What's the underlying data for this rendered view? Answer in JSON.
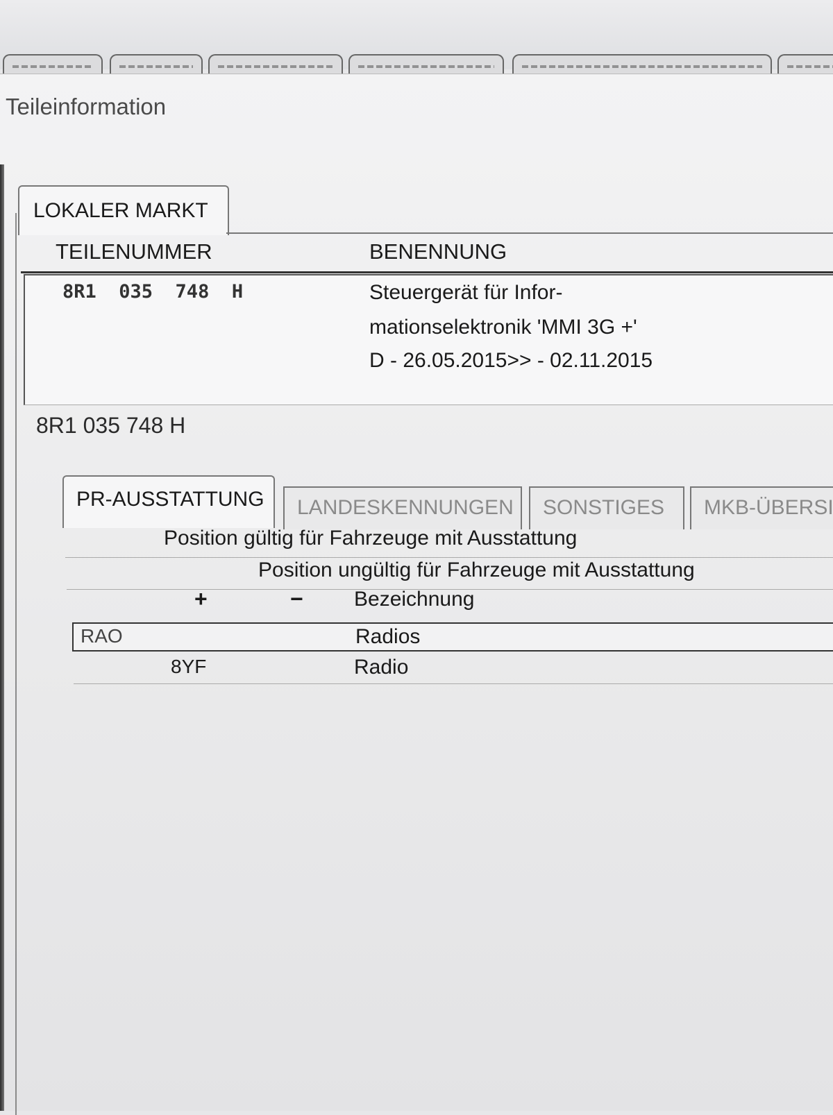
{
  "window": {
    "title": "Teileinformation"
  },
  "main_tab": {
    "label": "LOKALER MARKT"
  },
  "parts_table": {
    "headers": {
      "part_number": "TEILENUMMER",
      "designation": "BENENNUNG"
    },
    "row": {
      "part_number": "8R1  035  748  H",
      "designation_lines": [
        "Steuergerät für Infor-",
        "mationselektronik 'MMI 3G +'",
        "D - 26.05.2015>> - 02.11.2015"
      ]
    }
  },
  "selected_part_number": "8R1 035 748 H",
  "sub_tabs": [
    {
      "label": "PR-AUSSTATTUNG",
      "active": true
    },
    {
      "label": "LANDESKENNUNGEN",
      "active": false
    },
    {
      "label": "SONSTIGES",
      "active": false
    },
    {
      "label": "MKB-ÜBERSICHT",
      "active": false
    }
  ],
  "pr_equipment": {
    "legend_valid": "Position gültig für Fahrzeuge mit Ausstattung",
    "legend_invalid": "Position ungültig für Fahrzeuge mit Ausstattung",
    "col_plus": "+",
    "col_minus": "−",
    "col_designation": "Bezeichnung",
    "group": {
      "code": "RAO",
      "name": "Radios"
    },
    "items": [
      {
        "plus_code": "8YF",
        "name": "Radio"
      }
    ]
  }
}
